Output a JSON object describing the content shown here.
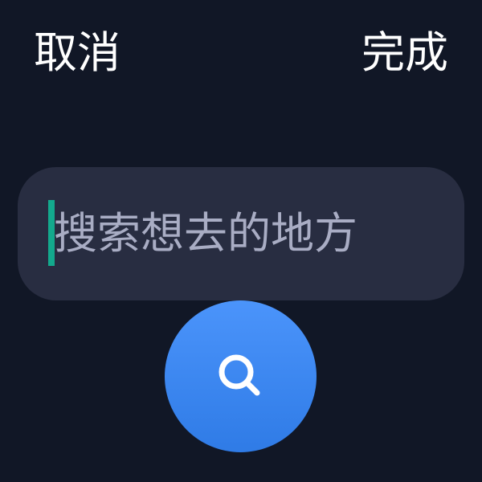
{
  "header": {
    "cancel_label": "取消",
    "done_label": "完成"
  },
  "search": {
    "placeholder": "搜索想去的地方",
    "value": ""
  },
  "search_button": {
    "icon": "search-icon"
  },
  "colors": {
    "background": "#111726",
    "field_background": "#282d41",
    "caret": "#13a98d",
    "accent": "#3b86f2",
    "text": "#ffffff",
    "placeholder": "#a9adc4"
  }
}
